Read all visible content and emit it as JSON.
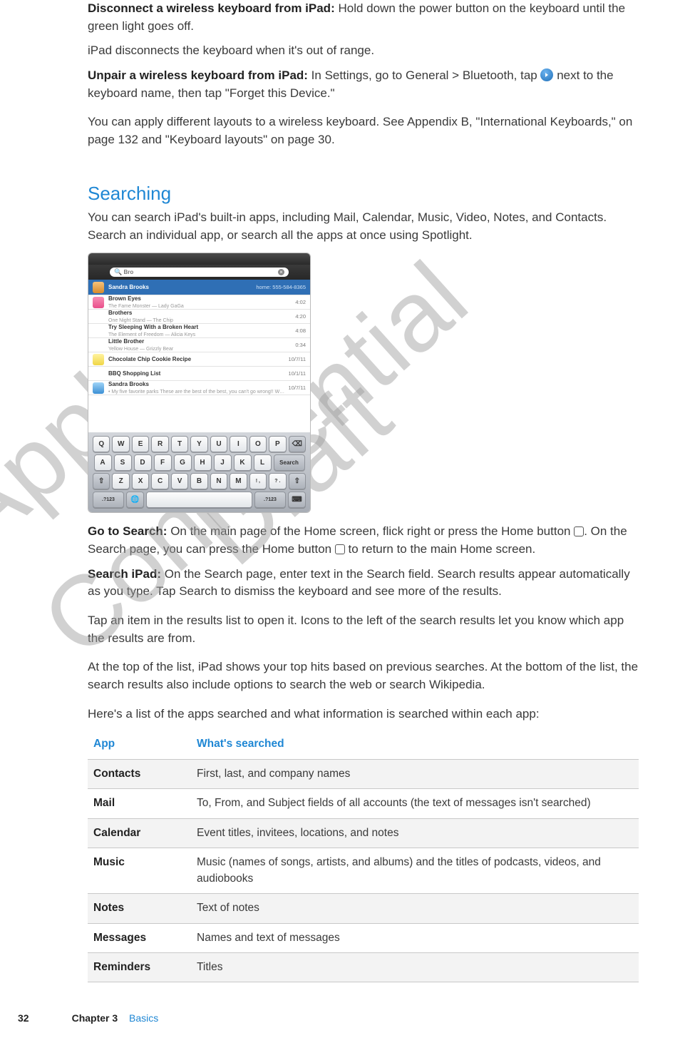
{
  "watermarks": {
    "draft": "Draft",
    "confidential": "Apple Confidential"
  },
  "paragraphs": {
    "disconnect_title": "Disconnect a wireless keyboard from iPad:",
    "disconnect_body": "  Hold down the power button on the keyboard until the green light goes off.",
    "out_of_range": "iPad disconnects the keyboard when it's out of range.",
    "unpair_title": "Unpair a wireless keyboard from iPad:",
    "unpair_body_a": "  In Settings, go to General > Bluetooth, tap ",
    "unpair_body_b": " next to the keyboard name, then tap \"Forget this Device.\"",
    "layouts": "You can apply different layouts to a wireless keyboard. See Appendix B, \"International Keyboards,\" on page 132 and \"Keyboard layouts\" on page 30.",
    "searching_heading": "Searching",
    "searching_intro": "You can search iPad's built-in apps, including Mail, Calendar, Music, Video, Notes, and Contacts. Search an individual app, or search all the apps at once using Spotlight.",
    "goto_title": "Go to Search:",
    "goto_body_a": "  On the main page of the Home screen, flick right or press the Home button ",
    "goto_body_b": ". On the Search page, you can press the Home button ",
    "goto_body_c": " to return to the main Home screen.",
    "searchipad_title": "Search iPad:",
    "searchipad_body": "  On the Search page, enter text in the Search field. Search results appear automatically as you type. Tap Search to dismiss the keyboard and see more of the results.",
    "tap_item": "Tap an item in the results list to open it. Icons to the left of the search results let you know which app the results are from.",
    "top_hits": "At the top of the list, iPad shows your top hits based on previous searches. At the bottom of the list, the search results also include options to search the web or search Wikipedia.",
    "table_intro": "Here's a list of the apps searched and what information is searched within each app:"
  },
  "screenshot": {
    "search_query": "Bro",
    "rows": [
      {
        "icon": "contact",
        "title": "Sandra Brooks",
        "sub": "",
        "meta": "home: 555-584-8365"
      },
      {
        "icon": "music",
        "title": "Brown Eyes",
        "sub": "The Fame Monster — Lady GaGa",
        "meta": "4:02"
      },
      {
        "icon": "",
        "title": "Brothers",
        "sub": "One Night Stand — The Chip",
        "meta": "4:20"
      },
      {
        "icon": "",
        "title": "Try Sleeping With a Broken Heart",
        "sub": "The Element of Freedom — Alicia Keys",
        "meta": "4:08"
      },
      {
        "icon": "",
        "title": "Little Brother",
        "sub": "Yellow House — Grizzly Bear",
        "meta": "0:34"
      },
      {
        "icon": "notes",
        "title": "Chocolate Chip Cookie Recipe",
        "sub": "",
        "meta": "10/7/11"
      },
      {
        "icon": "",
        "title": "BBQ Shopping List",
        "sub": "",
        "meta": "10/1/11"
      },
      {
        "icon": "mail",
        "title": "Sandra Brooks",
        "sub": "• My five favorite parks   These are the best of the best, you can't go wrong!!  Wrangell-St. Elias - …",
        "meta": "10/7/11"
      }
    ],
    "keyboard": {
      "r1": [
        "Q",
        "W",
        "E",
        "R",
        "T",
        "Y",
        "U",
        "I",
        "O",
        "P"
      ],
      "r2": [
        "A",
        "S",
        "D",
        "F",
        "G",
        "H",
        "J",
        "K",
        "L"
      ],
      "r2_search": "Search",
      "r3_shift": "⇧",
      "r3": [
        "Z",
        "X",
        "C",
        "V",
        "B",
        "N",
        "M"
      ],
      "r3_punc1": "!\n,",
      "r3_punc2": "?\n.",
      "r3_shift2": "⇧",
      "r4_numkey": ".?123",
      "r4_globe": "🌐",
      "r4_numkey2": ".?123",
      "r4_hide": "⌨"
    }
  },
  "table": {
    "headers": {
      "app": "App",
      "what": "What's searched"
    },
    "rows": [
      {
        "app": "Contacts",
        "what": "First, last, and company names"
      },
      {
        "app": "Mail",
        "what": "To, From, and Subject fields of all accounts (the text of messages isn't searched)"
      },
      {
        "app": "Calendar",
        "what": "Event titles, invitees, locations, and notes"
      },
      {
        "app": "Music",
        "what": "Music (names of songs, artists, and albums) and the titles of podcasts, videos, and audiobooks"
      },
      {
        "app": "Notes",
        "what": "Text of notes"
      },
      {
        "app": "Messages",
        "what": "Names and text of messages"
      },
      {
        "app": "Reminders",
        "what": "Titles"
      }
    ]
  },
  "footer": {
    "page_number": "32",
    "chapter_label": "Chapter 3",
    "chapter_name": "Basics"
  }
}
